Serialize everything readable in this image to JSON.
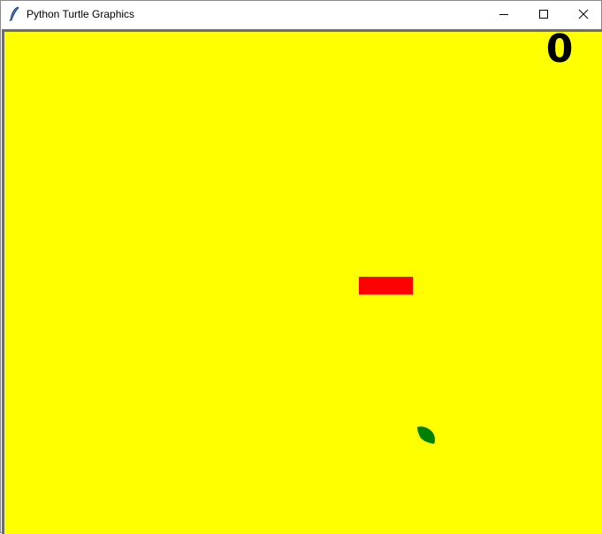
{
  "window": {
    "title": "Python Turtle Graphics",
    "icon": "feather-icon"
  },
  "controls": {
    "minimize_icon": "minimize-icon",
    "maximize_icon": "maximize-icon",
    "close_icon": "close-icon"
  },
  "game": {
    "score": "0",
    "background_color": "#ffff00",
    "snake_color": "#ff0000",
    "food_color": "#008000",
    "food_icon": "leaf-icon"
  }
}
